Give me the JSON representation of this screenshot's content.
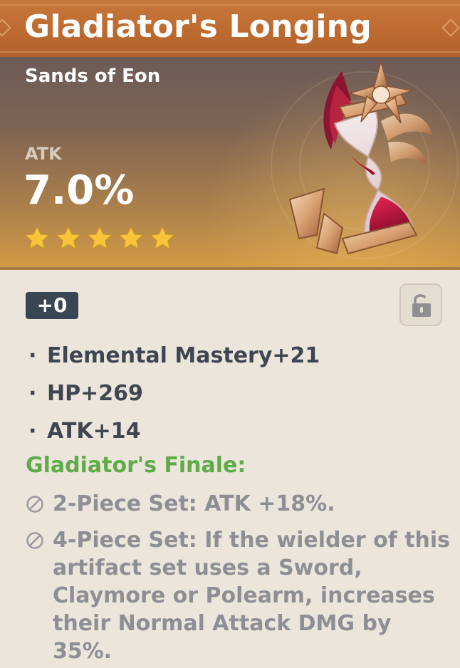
{
  "title": "Gladiator's Longing",
  "hero": {
    "slot": "Sands of Eon",
    "main_stat_name": "ATK",
    "main_stat_value": "7.0%",
    "rarity_stars": 5,
    "star_icon": "star-icon",
    "star_color": "#f7c53a"
  },
  "level": "+0",
  "lock_icon": "unlock-icon",
  "substats": [
    {
      "bullet": "·",
      "text": "Elemental Mastery+21"
    },
    {
      "bullet": "·",
      "text": "HP+269"
    },
    {
      "bullet": "·",
      "text": "ATK+14"
    }
  ],
  "set": {
    "name": "Gladiator's Finale:",
    "name_color": "#5eab48",
    "effects": [
      {
        "icon": "inactive-bonus-icon",
        "text": "2-Piece Set: ATK +18%."
      },
      {
        "icon": "inactive-bonus-icon",
        "text": "4-Piece Set: If the wielder of this artifact set uses a Sword, Claymore or Polearm, increases their Normal Attack DMG by 35%."
      }
    ]
  },
  "colors": {
    "title_bar": "#bd6a30",
    "panel_bg": "#ebe5dc",
    "badge_bg": "#3a4554",
    "text_dark": "#3f4652",
    "text_muted": "#8e8f95"
  }
}
